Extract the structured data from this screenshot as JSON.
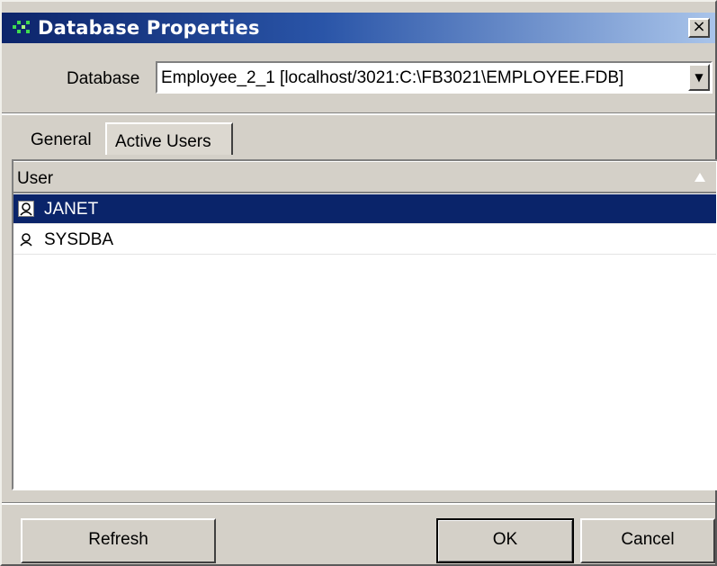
{
  "window": {
    "title": "Database Properties",
    "close_glyph": "×"
  },
  "database": {
    "label": "Database",
    "selected": "Employee_2_1 [localhost/3021:C:\\FB3021\\EMPLOYEE.FDB]",
    "dropdown_glyph": "▼"
  },
  "tabs": [
    {
      "label": "General",
      "selected": false
    },
    {
      "label": "Active Users",
      "selected": true
    }
  ],
  "users_list": {
    "column_header": "User",
    "sort_icon": "sort-ascending-icon",
    "rows": [
      {
        "name": "JANET",
        "icon": "user-icon",
        "selected": true
      },
      {
        "name": "SYSDBA",
        "icon": "user-icon",
        "selected": false
      }
    ]
  },
  "buttons": {
    "refresh": "Refresh",
    "ok": "OK",
    "cancel": "Cancel"
  },
  "colors": {
    "titlebar_start": "#0c246a",
    "titlebar_end": "#a9c4ea",
    "selection": "#0a246a",
    "dialog_face": "#d4d0c8"
  }
}
